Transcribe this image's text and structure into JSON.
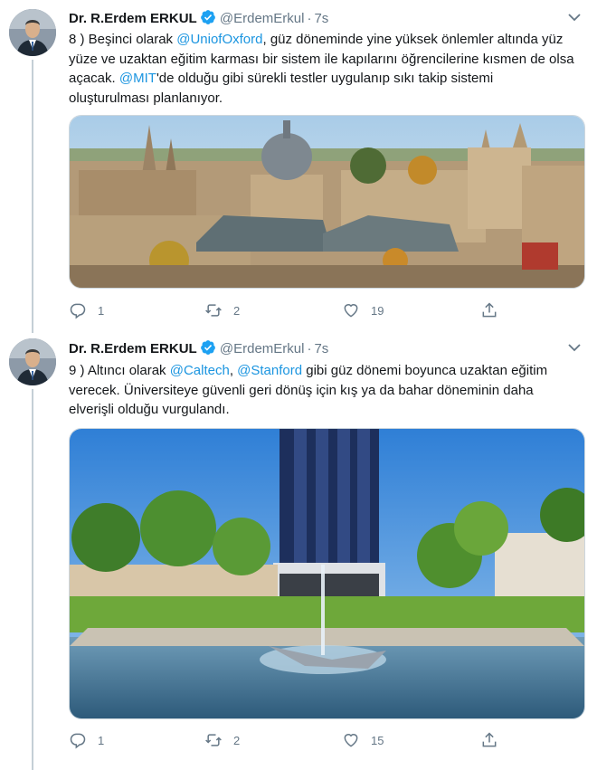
{
  "tweets": [
    {
      "author_name": "Dr. R.Erdem ERKUL",
      "handle": "@ErdemErkul",
      "separator": "·",
      "time": "7s",
      "text": {
        "p1": "8 ) Beşinci olarak ",
        "m1": "@UniofOxford",
        "p2": ", güz döneminde yine yüksek önlemler altında yüz yüze ve uzaktan eğitim karması bir sistem ile kapılarını öğrencilerine kısmen de olsa açacak. ",
        "m2": "@MIT",
        "p3": "'de olduğu gibi sürekli testler uygulanıp sıkı takip sistemi oluşturulması planlanıyor."
      },
      "replies": "1",
      "retweets": "2",
      "likes": "19"
    },
    {
      "author_name": "Dr. R.Erdem ERKUL",
      "handle": "@ErdemErkul",
      "separator": "·",
      "time": "7s",
      "text": {
        "p1": "9 ) Altıncı olarak ",
        "m1": "@Caltech",
        "p2": ", ",
        "m2": "@Stanford",
        "p3": " gibi güz dönemi boyunca uzaktan eğitim verecek.  Üniversiteye güvenli geri dönüş için kış ya da bahar döneminin daha elverişli olduğu vurgulandı."
      },
      "replies": "1",
      "retweets": "2",
      "likes": "15"
    }
  ],
  "icons": {
    "verified": "verified-badge-icon",
    "caret": "chevron-down-icon",
    "reply": "reply-icon",
    "retweet": "retweet-icon",
    "like": "heart-icon",
    "share": "share-icon"
  },
  "colors": {
    "link": "#1b95e0",
    "verified": "#1da1f2",
    "muted": "#657786",
    "text": "#14171a"
  }
}
